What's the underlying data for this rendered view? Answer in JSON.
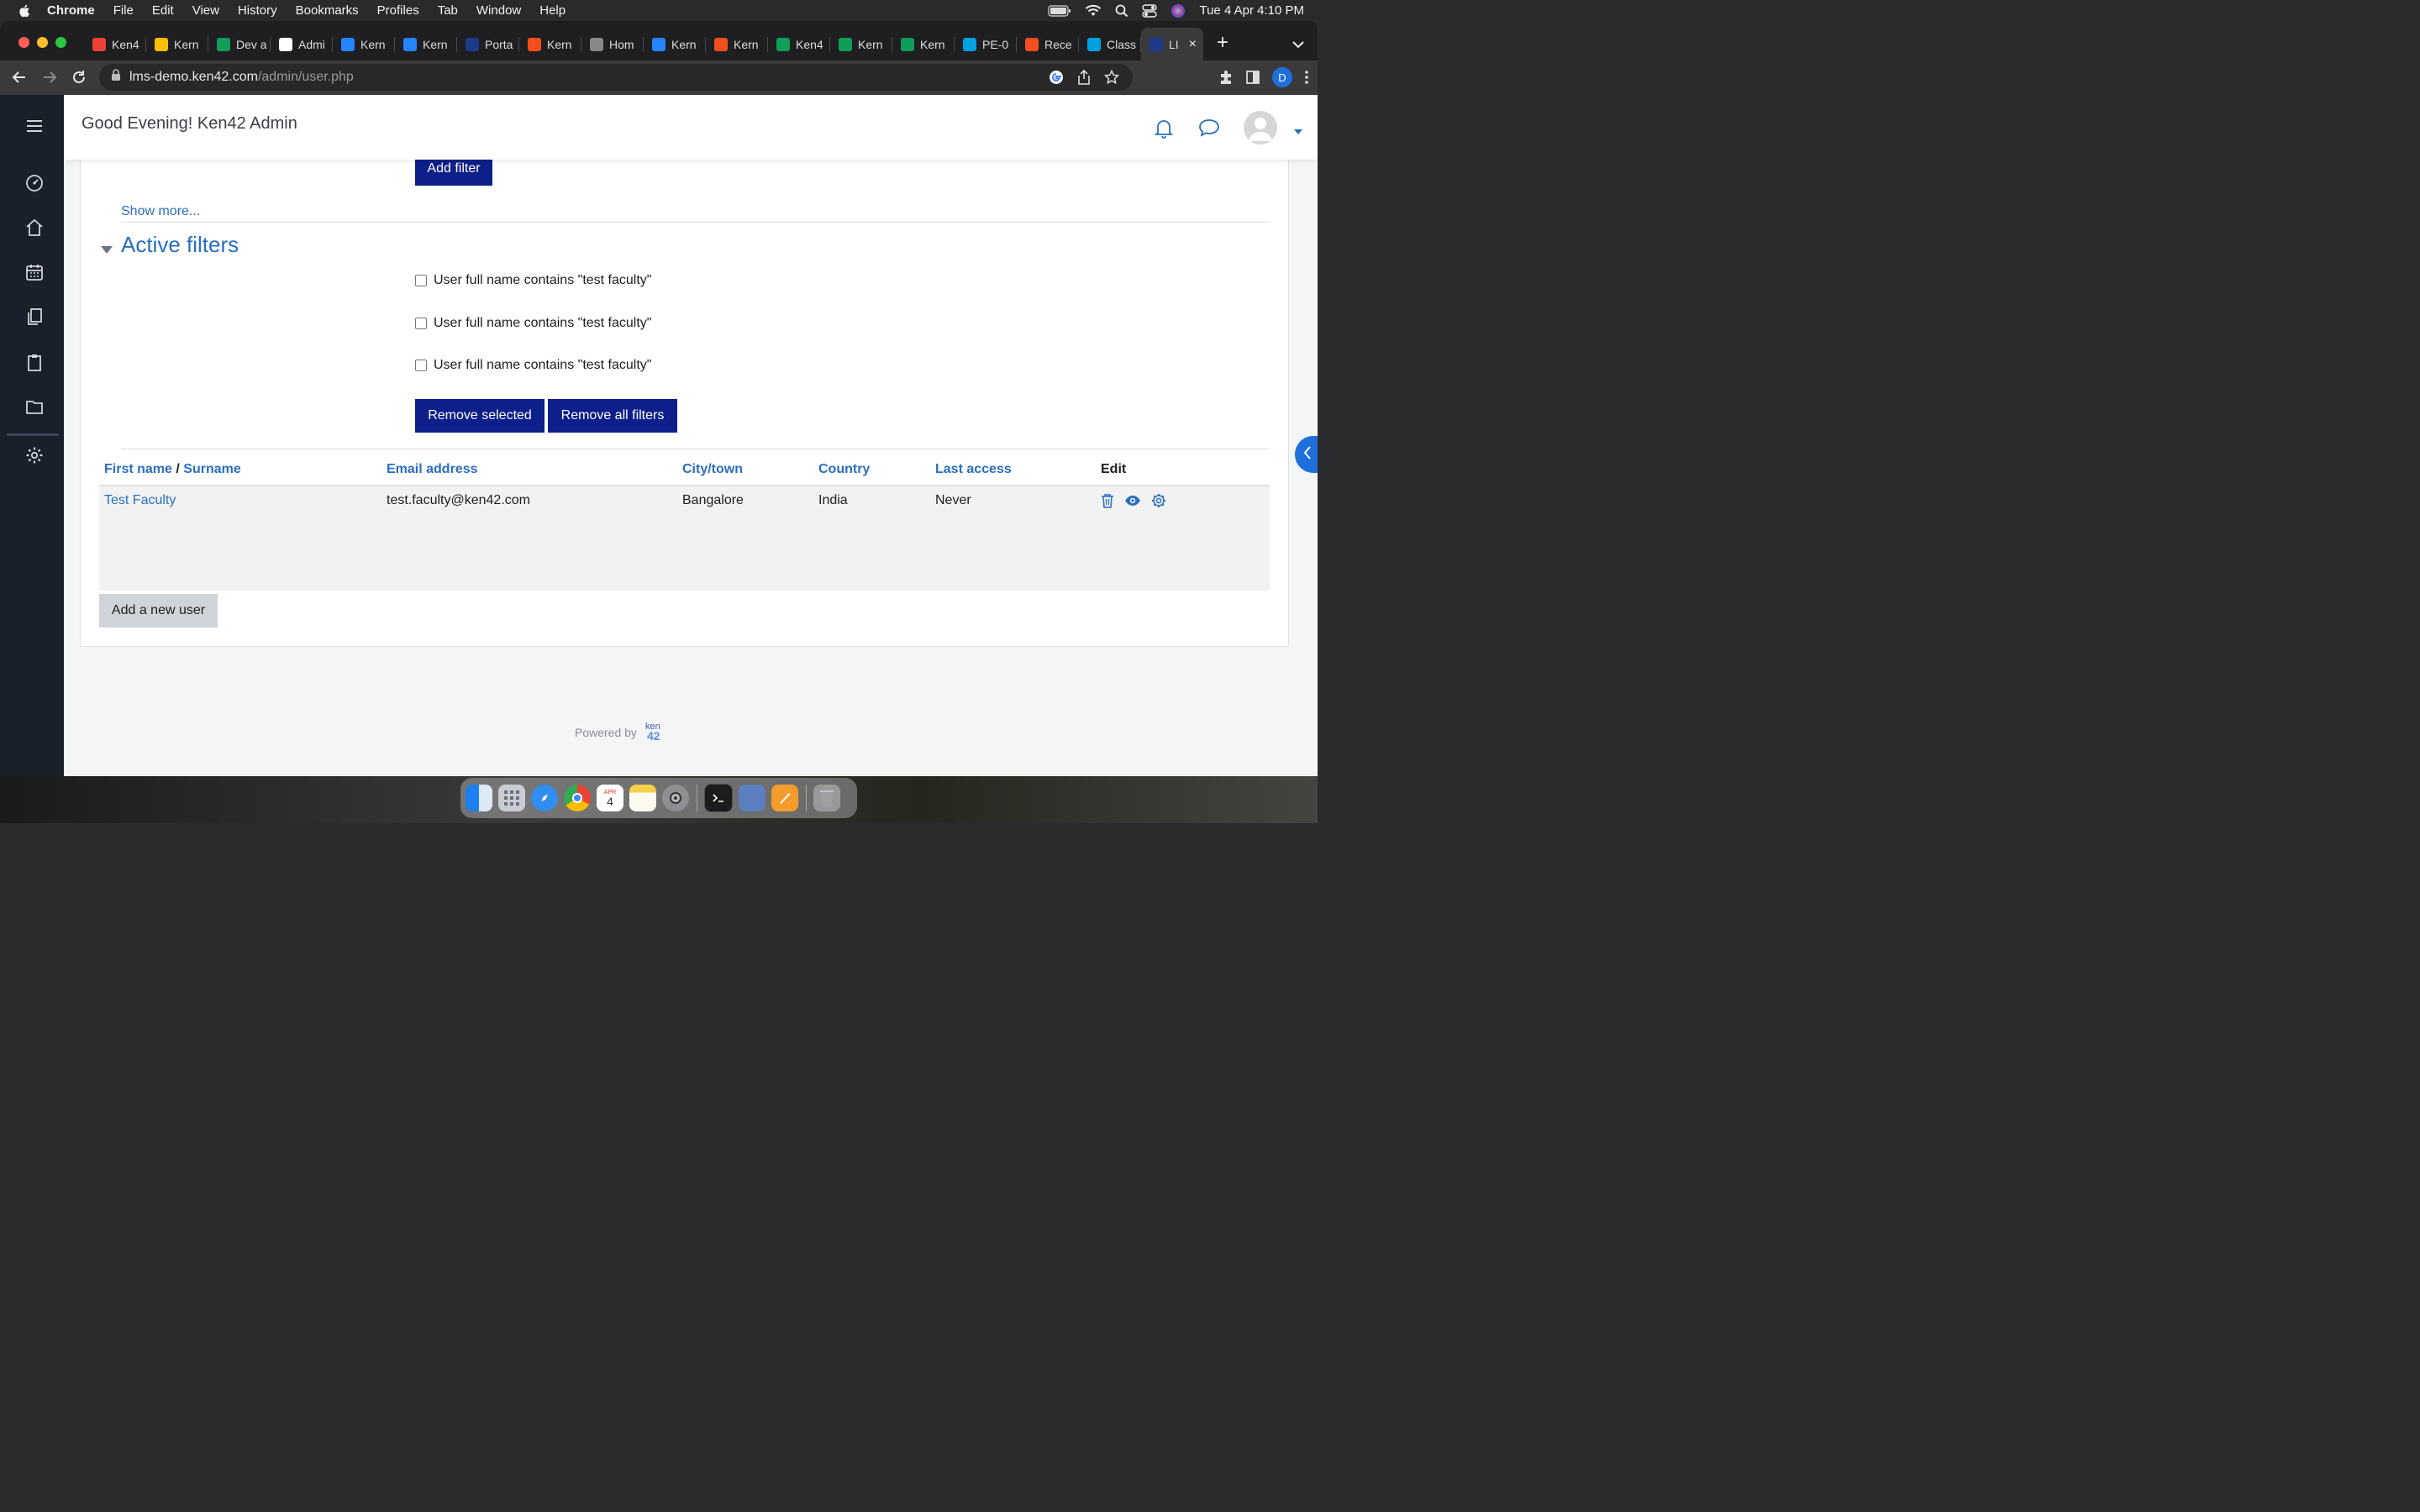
{
  "menubar": {
    "app": "Chrome",
    "items": [
      "File",
      "Edit",
      "View",
      "History",
      "Bookmarks",
      "Profiles",
      "Tab",
      "Window",
      "Help"
    ],
    "clock": "Tue 4 Apr  4:10 PM"
  },
  "tabs": [
    {
      "label": "Ken4",
      "icon": "gmail-icon",
      "color": "#ea4335"
    },
    {
      "label": "Kern",
      "icon": "drive-icon",
      "color": "#fbbc04"
    },
    {
      "label": "Dev a",
      "icon": "sheets-icon",
      "color": "#0f9d58"
    },
    {
      "label": "Admi",
      "icon": "ken42-icon",
      "color": "#ffffff"
    },
    {
      "label": "Kern",
      "icon": "jira-icon",
      "color": "#2684ff"
    },
    {
      "label": "Kern",
      "icon": "jira-icon",
      "color": "#2684ff"
    },
    {
      "label": "Porta",
      "icon": "ken42-icon",
      "color": "#1e3a8a"
    },
    {
      "label": "Kern",
      "icon": "figma-icon",
      "color": "#f24e1e"
    },
    {
      "label": "Hom",
      "icon": "globe-icon",
      "color": "#888888"
    },
    {
      "label": "Kern",
      "icon": "jira-icon",
      "color": "#2684ff"
    },
    {
      "label": "Kern",
      "icon": "figma-icon",
      "color": "#f24e1e"
    },
    {
      "label": "Ken4",
      "icon": "sheets-icon",
      "color": "#0f9d58"
    },
    {
      "label": "Kern",
      "icon": "sheets-icon",
      "color": "#0f9d58"
    },
    {
      "label": "Kern",
      "icon": "sheets-icon",
      "color": "#0f9d58"
    },
    {
      "label": "PE-0",
      "icon": "salesforce-icon",
      "color": "#00a1e0"
    },
    {
      "label": "Rece",
      "icon": "figma-icon",
      "color": "#f24e1e"
    },
    {
      "label": "Class",
      "icon": "salesforce-icon",
      "color": "#00a1e0"
    },
    {
      "label": "LI",
      "icon": "ken42-icon",
      "color": "#1e3a8a",
      "active": true
    }
  ],
  "address": {
    "host": "lms-demo.ken42.com",
    "path": "/admin/user.php"
  },
  "profile_initial": "D",
  "header": {
    "greeting": "Good Evening! Ken42 Admin"
  },
  "filters": {
    "add_filter_label": "Add filter",
    "show_more_label": "Show more...",
    "active_title": "Active filters",
    "active": [
      "User full name contains \"test faculty\"",
      "User full name contains \"test faculty\"",
      "User full name contains \"test faculty\""
    ],
    "remove_selected_label": "Remove selected",
    "remove_all_label": "Remove all filters"
  },
  "table": {
    "col_first": "First name",
    "col_sep": "/",
    "col_surname": "Surname",
    "col_email": "Email address",
    "col_city": "City/town",
    "col_country": "Country",
    "col_access": "Last access",
    "col_edit": "Edit",
    "rows": [
      {
        "name": "Test Faculty",
        "email": "test.faculty@ken42.com",
        "city": "Bangalore",
        "country": "India",
        "access": "Never"
      }
    ]
  },
  "add_user_label": "Add a new user",
  "footer": {
    "powered_by": "Powered by",
    "logo_text": "ken 42"
  },
  "dock_calendar": {
    "month": "APR",
    "day": "4"
  },
  "colors": {
    "primary_button": "#0d1f8a",
    "link": "#2a6ebf",
    "sidebar": "#1a1f2c"
  }
}
